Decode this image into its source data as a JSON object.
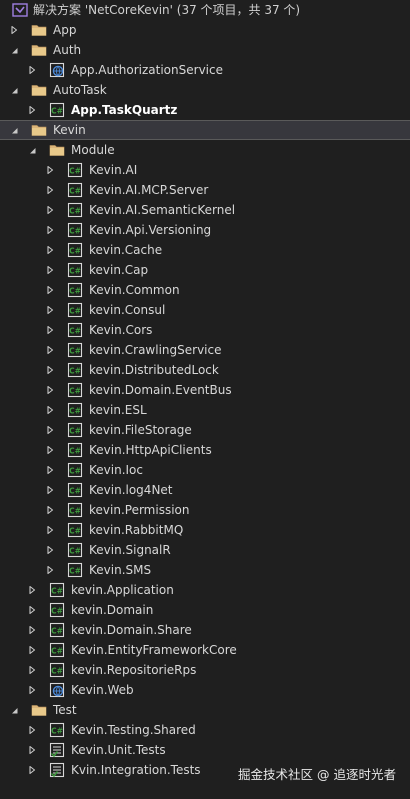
{
  "header": {
    "title": "解决方案 'NetCoreKevin' (37 个项目，共 37 个)"
  },
  "tree": [
    {
      "label": "App",
      "type": "folder",
      "depth": 0,
      "expanded": false
    },
    {
      "label": "Auth",
      "type": "folder",
      "depth": 0,
      "expanded": true
    },
    {
      "label": "App.AuthorizationService",
      "type": "web",
      "depth": 1,
      "expanded": false
    },
    {
      "label": "AutoTask",
      "type": "folder",
      "depth": 0,
      "expanded": true
    },
    {
      "label": "App.TaskQuartz",
      "type": "csharp",
      "depth": 1,
      "expanded": false,
      "bold": true
    },
    {
      "label": "Kevin",
      "type": "folder",
      "depth": 0,
      "expanded": true,
      "selected": true
    },
    {
      "label": "Module",
      "type": "folder",
      "depth": 1,
      "expanded": true
    },
    {
      "label": "Kevin.AI",
      "type": "csharp",
      "depth": 2,
      "expanded": false
    },
    {
      "label": "Kevin.AI.MCP.Server",
      "type": "csharp",
      "depth": 2,
      "expanded": false
    },
    {
      "label": "Kevin.AI.SemanticKernel",
      "type": "csharp",
      "depth": 2,
      "expanded": false
    },
    {
      "label": "Kevin.Api.Versioning",
      "type": "csharp",
      "depth": 2,
      "expanded": false
    },
    {
      "label": "kevin.Cache",
      "type": "csharp",
      "depth": 2,
      "expanded": false
    },
    {
      "label": "kevin.Cap",
      "type": "csharp",
      "depth": 2,
      "expanded": false
    },
    {
      "label": "Kevin.Common",
      "type": "csharp",
      "depth": 2,
      "expanded": false
    },
    {
      "label": "kevin.Consul",
      "type": "csharp",
      "depth": 2,
      "expanded": false
    },
    {
      "label": "Kevin.Cors",
      "type": "csharp",
      "depth": 2,
      "expanded": false
    },
    {
      "label": "kevin.CrawlingService",
      "type": "csharp",
      "depth": 2,
      "expanded": false
    },
    {
      "label": "kevin.DistributedLock",
      "type": "csharp",
      "depth": 2,
      "expanded": false
    },
    {
      "label": "kevin.Domain.EventBus",
      "type": "csharp",
      "depth": 2,
      "expanded": false
    },
    {
      "label": "kevin.ESL",
      "type": "csharp",
      "depth": 2,
      "expanded": false
    },
    {
      "label": "kevin.FileStorage",
      "type": "csharp",
      "depth": 2,
      "expanded": false
    },
    {
      "label": "Kevin.HttpApiClients",
      "type": "csharp",
      "depth": 2,
      "expanded": false
    },
    {
      "label": "Kevin.Ioc",
      "type": "csharp",
      "depth": 2,
      "expanded": false
    },
    {
      "label": "Kevin.log4Net",
      "type": "csharp",
      "depth": 2,
      "expanded": false
    },
    {
      "label": "kevin.Permission",
      "type": "csharp",
      "depth": 2,
      "expanded": false
    },
    {
      "label": "kevin.RabbitMQ",
      "type": "csharp",
      "depth": 2,
      "expanded": false
    },
    {
      "label": "Kevin.SignalR",
      "type": "csharp",
      "depth": 2,
      "expanded": false
    },
    {
      "label": "Kevin.SMS",
      "type": "csharp",
      "depth": 2,
      "expanded": false
    },
    {
      "label": "kevin.Application",
      "type": "csharp",
      "depth": 1,
      "expanded": false
    },
    {
      "label": "kevin.Domain",
      "type": "csharp",
      "depth": 1,
      "expanded": false
    },
    {
      "label": "kevin.Domain.Share",
      "type": "csharp",
      "depth": 1,
      "expanded": false
    },
    {
      "label": "Kevin.EntityFrameworkCore",
      "type": "csharp",
      "depth": 1,
      "expanded": false
    },
    {
      "label": "kevin.RepositorieRps",
      "type": "csharp",
      "depth": 1,
      "expanded": false
    },
    {
      "label": "Kevin.Web",
      "type": "web",
      "depth": 1,
      "expanded": false
    },
    {
      "label": "Test",
      "type": "folder",
      "depth": 0,
      "expanded": true
    },
    {
      "label": "Kevin.Testing.Shared",
      "type": "csharp",
      "depth": 1,
      "expanded": false
    },
    {
      "label": "Kevin.Unit.Tests",
      "type": "test",
      "depth": 1,
      "expanded": false
    },
    {
      "label": "Kvin.Integration.Tests",
      "type": "test",
      "depth": 1,
      "expanded": false
    }
  ],
  "watermark": "掘金技术社区 @ 追逐时光者",
  "colors": {
    "background": "#1f1f1f",
    "selection": "#37373d",
    "folder": "#dcb67a",
    "csharp_icon": "#3f9b3f",
    "web_icon": "#4d8ad8",
    "solution_icon": "#9f7fe0",
    "text": "#d8d8d8"
  }
}
